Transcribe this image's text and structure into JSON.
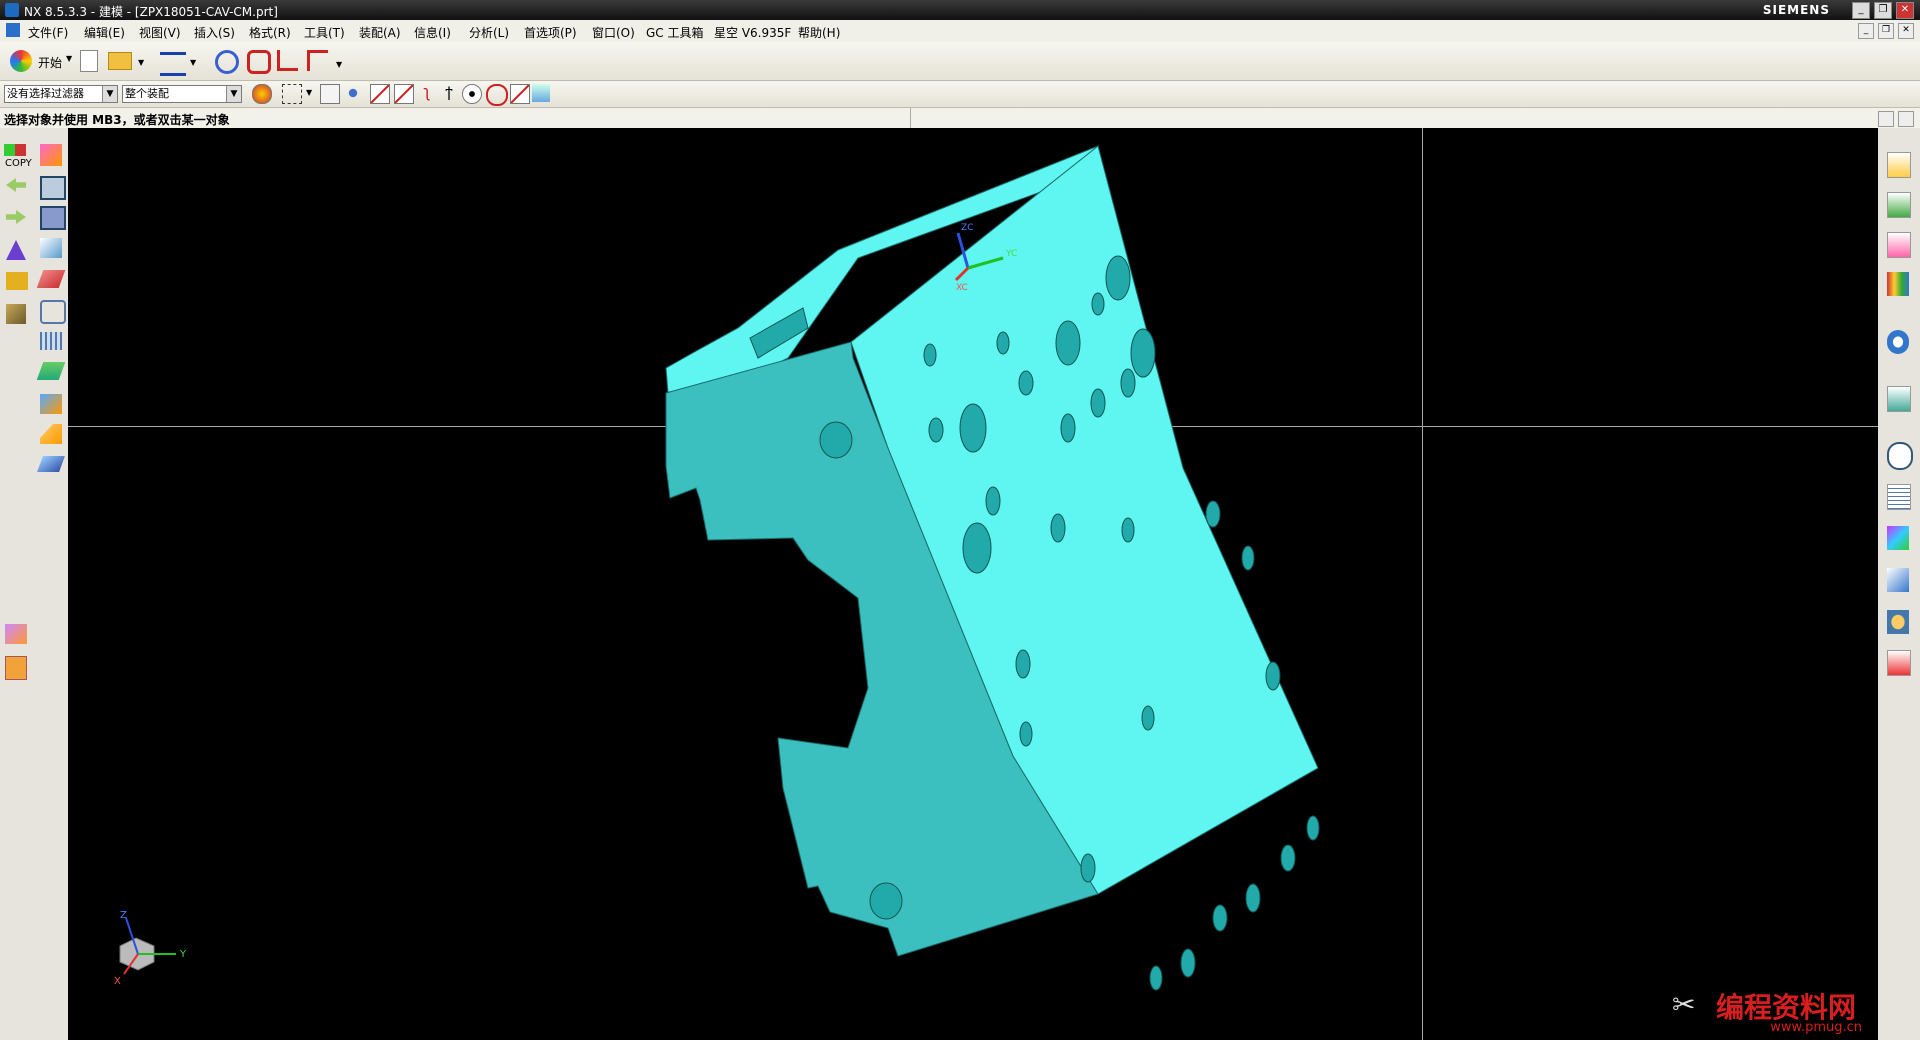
{
  "window": {
    "title": "NX 8.5.3.3 - 建模 - [ZPX18051-CAV-CM.prt]",
    "brand": "SIEMENS",
    "minimize": "_",
    "restore": "❐",
    "close": "✕"
  },
  "menu": {
    "items": [
      "文件(F)",
      "编辑(E)",
      "视图(V)",
      "插入(S)",
      "格式(R)",
      "工具(T)",
      "装配(A)",
      "信息(I)",
      "分析(L)",
      "首选项(P)",
      "窗口(O)",
      "GC 工具箱",
      "星空 V6.935F",
      "帮助(H)"
    ]
  },
  "toolbar": {
    "start_label": "开始"
  },
  "selection": {
    "filter": "没有选择过滤器",
    "scope": "整个装配"
  },
  "status": {
    "message": "选择对象并使用 MB3，或者双击某一对象"
  },
  "leftbar": {
    "copy_label": "COPY"
  },
  "viewport": {
    "wcs": {
      "z": "ZC",
      "y": "YC",
      "x": "XC"
    },
    "triad": {
      "z": "Z",
      "y": "Y",
      "x": "X"
    },
    "part_color": "#5ff5f0",
    "part_shade": "#3cbfbf"
  },
  "watermark": {
    "title": "编程资料网",
    "url": "www.pmug.cn"
  },
  "colors": {
    "background": "#000000",
    "chrome": "#d4d0c8"
  }
}
